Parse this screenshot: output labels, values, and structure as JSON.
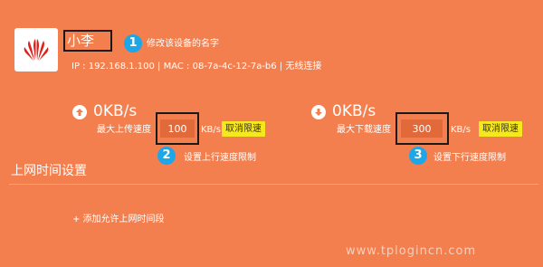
{
  "device": {
    "name": "小李",
    "info": "IP : 192.168.1.100 | MAC : 08-7a-4c-12-7a-b6 | 无线连接",
    "logo_icon": "huawei-logo"
  },
  "callouts": [
    {
      "number": "1",
      "text": "修改该设备的名字"
    },
    {
      "number": "2",
      "text": "设置上行速度限制"
    },
    {
      "number": "3",
      "text": "设置下行速度限制"
    }
  ],
  "upload": {
    "speed": "0KB/s",
    "limit_label": "最大上传速度",
    "limit_value": "100",
    "unit": "KB/s",
    "cancel_label": "取消限速",
    "icon": "arrow-up-icon"
  },
  "download": {
    "speed": "0KB/s",
    "limit_label": "最大下载速度",
    "limit_value": "300",
    "unit": "KB/s",
    "cancel_label": "取消限速",
    "icon": "arrow-down-icon"
  },
  "online_time": {
    "title": "上网时间设置",
    "add_link": "+ 添加允许上网时间段"
  },
  "watermark": "www.tplogincn.com",
  "colors": {
    "background": "#f47f4e",
    "callout": "#1da6e8",
    "cancel_button": "#f6e820",
    "input": "#e26a3a",
    "frame": "#1a1a1a"
  }
}
